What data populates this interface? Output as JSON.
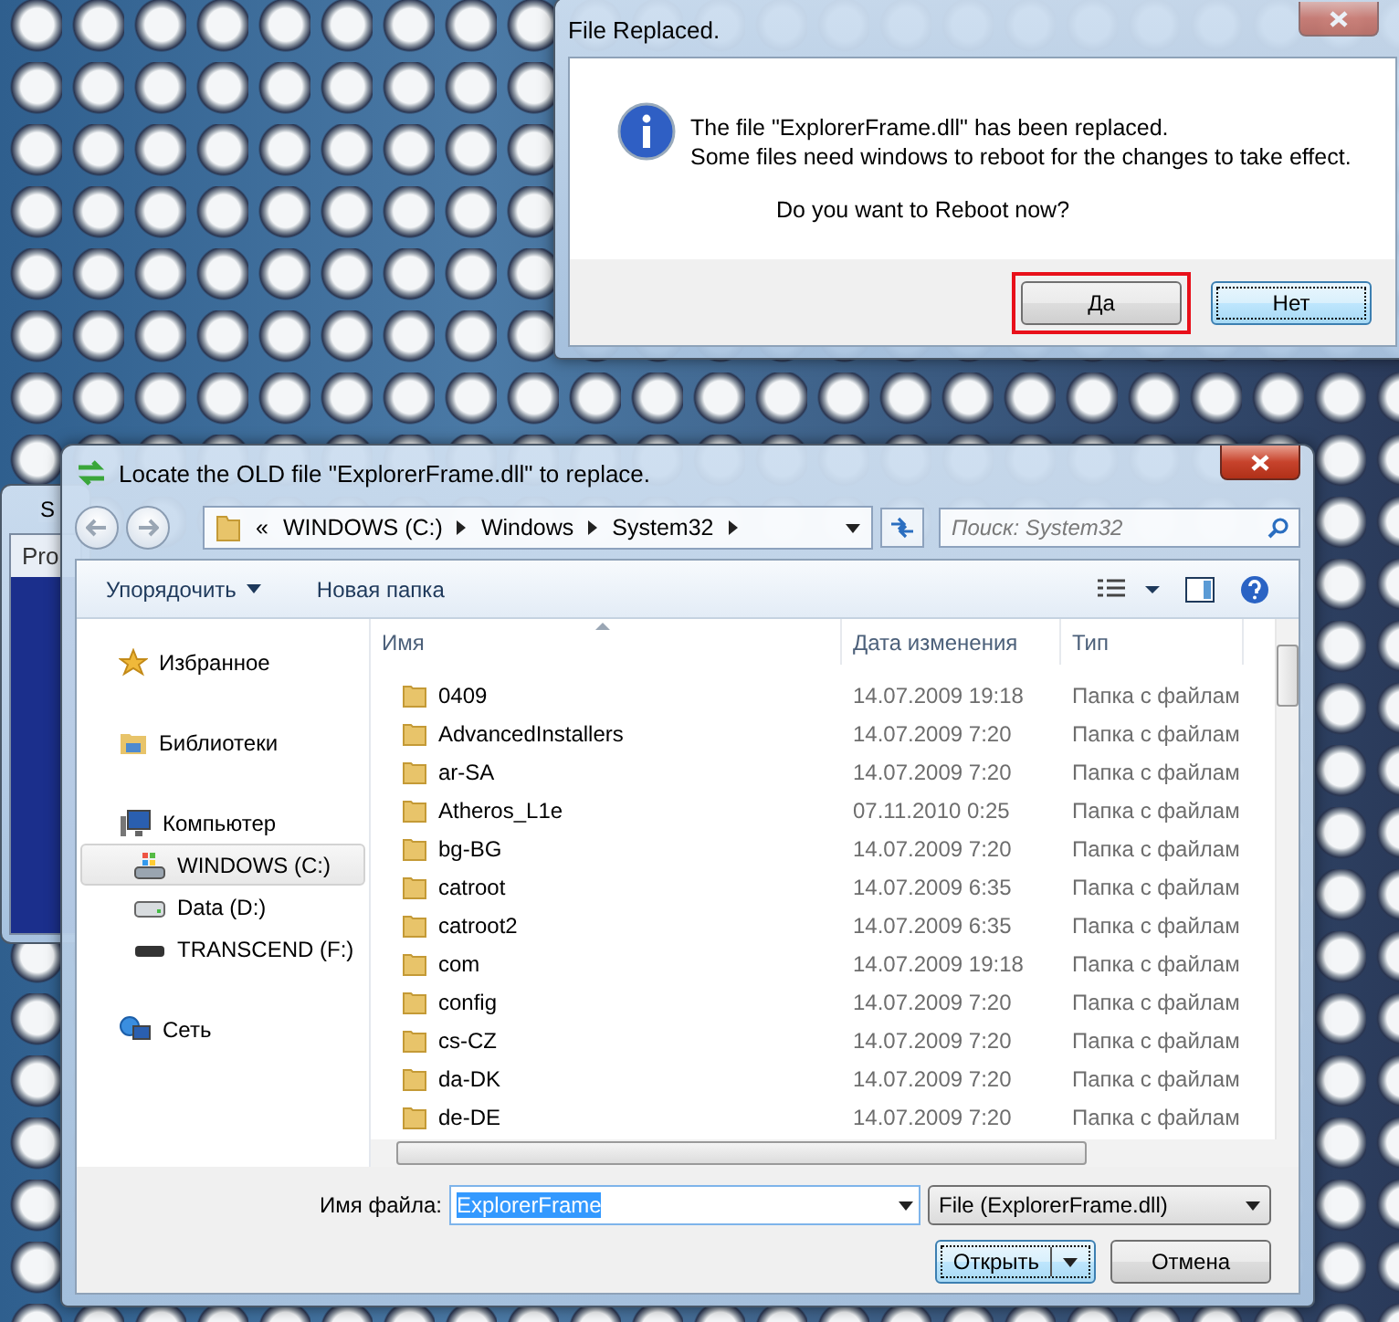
{
  "desktop_window": {
    "title": "S",
    "tab": "Pro"
  },
  "file_dialog": {
    "title": "Locate the OLD file \"ExplorerFrame.dll\" to replace.",
    "breadcrumb": [
      "«",
      "WINDOWS (C:)",
      "Windows",
      "System32"
    ],
    "search": {
      "placeholder": "Поиск: System32"
    },
    "toolbar": [
      {
        "label": "Упорядочить",
        "kind": "menu"
      },
      {
        "label": "Новая папка",
        "kind": "plain"
      }
    ],
    "sidebar": [
      {
        "label": "Избранное",
        "kind": "favorites",
        "selected": false
      },
      {
        "label": "Библиотеки",
        "kind": "libraries",
        "selected": false
      },
      {
        "label": "Компьютер",
        "kind": "computer",
        "selected": false,
        "children": [
          {
            "label": "WINDOWS (C:)",
            "kind": "system-drive",
            "selected": true
          },
          {
            "label": "Data (D:)",
            "kind": "drive",
            "selected": false
          },
          {
            "label": "TRANSCEND (F:)",
            "kind": "usb-drive",
            "selected": false
          }
        ]
      },
      {
        "label": "Сеть",
        "kind": "network",
        "selected": false
      }
    ],
    "columns": [
      "Имя",
      "Дата изменения",
      "Тип"
    ],
    "rows": [
      {
        "name": "0409",
        "date": "14.07.2009 19:18",
        "type": "Папка с файлам"
      },
      {
        "name": "AdvancedInstallers",
        "date": "14.07.2009 7:20",
        "type": "Папка с файлам"
      },
      {
        "name": "ar-SA",
        "date": "14.07.2009 7:20",
        "type": "Папка с файлам"
      },
      {
        "name": "Atheros_L1e",
        "date": "07.11.2010 0:25",
        "type": "Папка с файлам"
      },
      {
        "name": "bg-BG",
        "date": "14.07.2009 7:20",
        "type": "Папка с файлам"
      },
      {
        "name": "catroot",
        "date": "14.07.2009 6:35",
        "type": "Папка с файлам"
      },
      {
        "name": "catroot2",
        "date": "14.07.2009 6:35",
        "type": "Папка с файлам"
      },
      {
        "name": "com",
        "date": "14.07.2009 19:18",
        "type": "Папка с файлам"
      },
      {
        "name": "config",
        "date": "14.07.2009 7:20",
        "type": "Папка с файлам"
      },
      {
        "name": "cs-CZ",
        "date": "14.07.2009 7:20",
        "type": "Папка с файлам"
      },
      {
        "name": "da-DK",
        "date": "14.07.2009 7:20",
        "type": "Папка с файлам"
      },
      {
        "name": "de-DE",
        "date": "14.07.2009 7:20",
        "type": "Папка с файлам"
      }
    ],
    "file_name": {
      "label": "Имя файла:",
      "value": "ExplorerFrame",
      "selected": true
    },
    "file_type": "File (ExplorerFrame.dll)",
    "buttons": [
      {
        "label": "Открыть",
        "kind": "split"
      },
      {
        "label": "Отмена",
        "kind": "plain"
      }
    ]
  },
  "message_box": {
    "title": "File Replaced.",
    "lines": [
      "The file \"ExplorerFrame.dll\" has been replaced.",
      "Some files need windows to reboot for the changes to take effect."
    ],
    "question": "Do you want to Reboot now?",
    "buttons": [
      {
        "label": "Да",
        "selected": true
      },
      {
        "label": "Нет",
        "selected": false
      }
    ]
  }
}
